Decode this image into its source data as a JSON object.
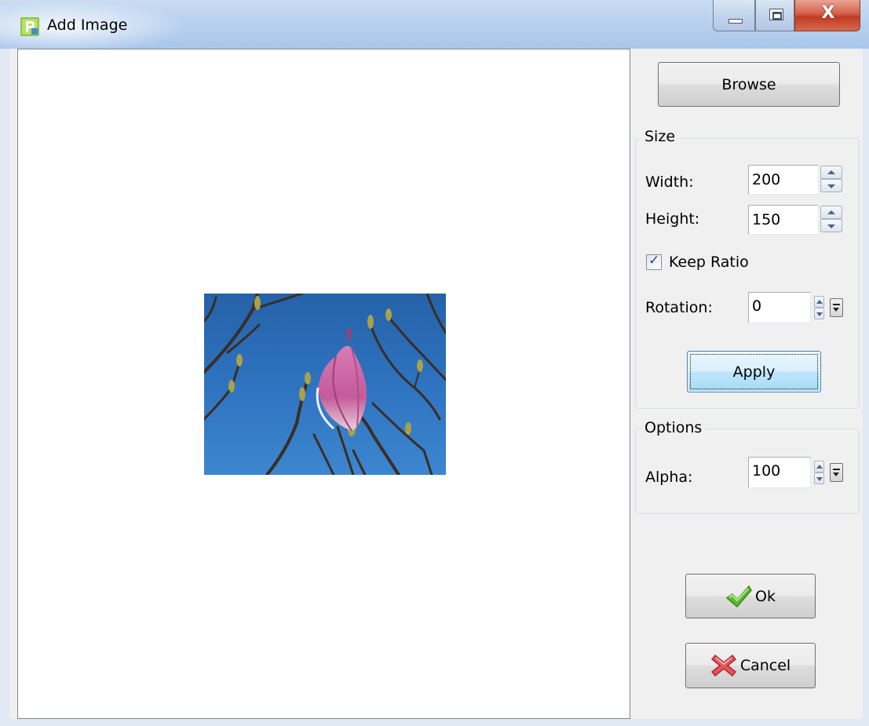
{
  "window": {
    "title": "Add Image",
    "controls": {
      "minimize": "minimize-icon",
      "maximize": "maximize-icon",
      "close": "X"
    }
  },
  "preview": {
    "image": "magnolia bud against blue sky"
  },
  "browse_label": "Browse",
  "size_group": {
    "title": "Size",
    "width_label": "Width:",
    "width_value": "200",
    "height_label": "Height:",
    "height_value": "150",
    "keep_ratio_label": "Keep Ratio",
    "keep_ratio_checked": true,
    "rotation_label": "Rotation:",
    "rotation_value": "0",
    "apply_label": "Apply"
  },
  "options_group": {
    "title": "Options",
    "alpha_label": "Alpha:",
    "alpha_value": "100"
  },
  "ok_label": "Ok",
  "cancel_label": "Cancel",
  "colors": {
    "titlebar": "#b9d1ee",
    "dialog_bg": "#f0f0f0",
    "close_button": "#c23a22",
    "apply_focus": "#3c7fb1",
    "sky": "#2e73c0"
  }
}
